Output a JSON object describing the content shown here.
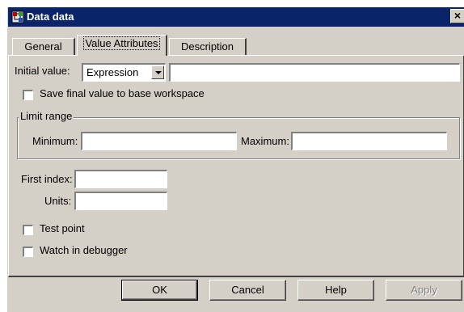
{
  "window": {
    "title": "Data data",
    "close_glyph": "×"
  },
  "tabs": [
    {
      "label": "General",
      "active": false
    },
    {
      "label": "Value Attributes",
      "active": true
    },
    {
      "label": "Description",
      "active": false
    }
  ],
  "form": {
    "initial_value_label": "Initial value:",
    "initial_value_mode": "Expression",
    "initial_value_text": "",
    "save_final_label": "Save final value to base workspace",
    "save_final_checked": false,
    "limit_range": {
      "title": "Limit range",
      "minimum_label": "Minimum:",
      "minimum_value": "",
      "maximum_label": "Maximum:",
      "maximum_value": ""
    },
    "first_index_label": "First index:",
    "first_index_value": "",
    "units_label": "Units:",
    "units_value": "",
    "test_point_label": "Test point",
    "test_point_checked": false,
    "watch_debugger_label": "Watch in debugger",
    "watch_debugger_checked": false
  },
  "buttons": {
    "ok": "OK",
    "cancel": "Cancel",
    "help": "Help",
    "apply": "Apply"
  },
  "icons": {
    "app_icon": "simulink-block-icon",
    "close_icon": "close-icon"
  },
  "colors": {
    "titlebar": "#0a246a",
    "face": "#d4d0c8"
  }
}
